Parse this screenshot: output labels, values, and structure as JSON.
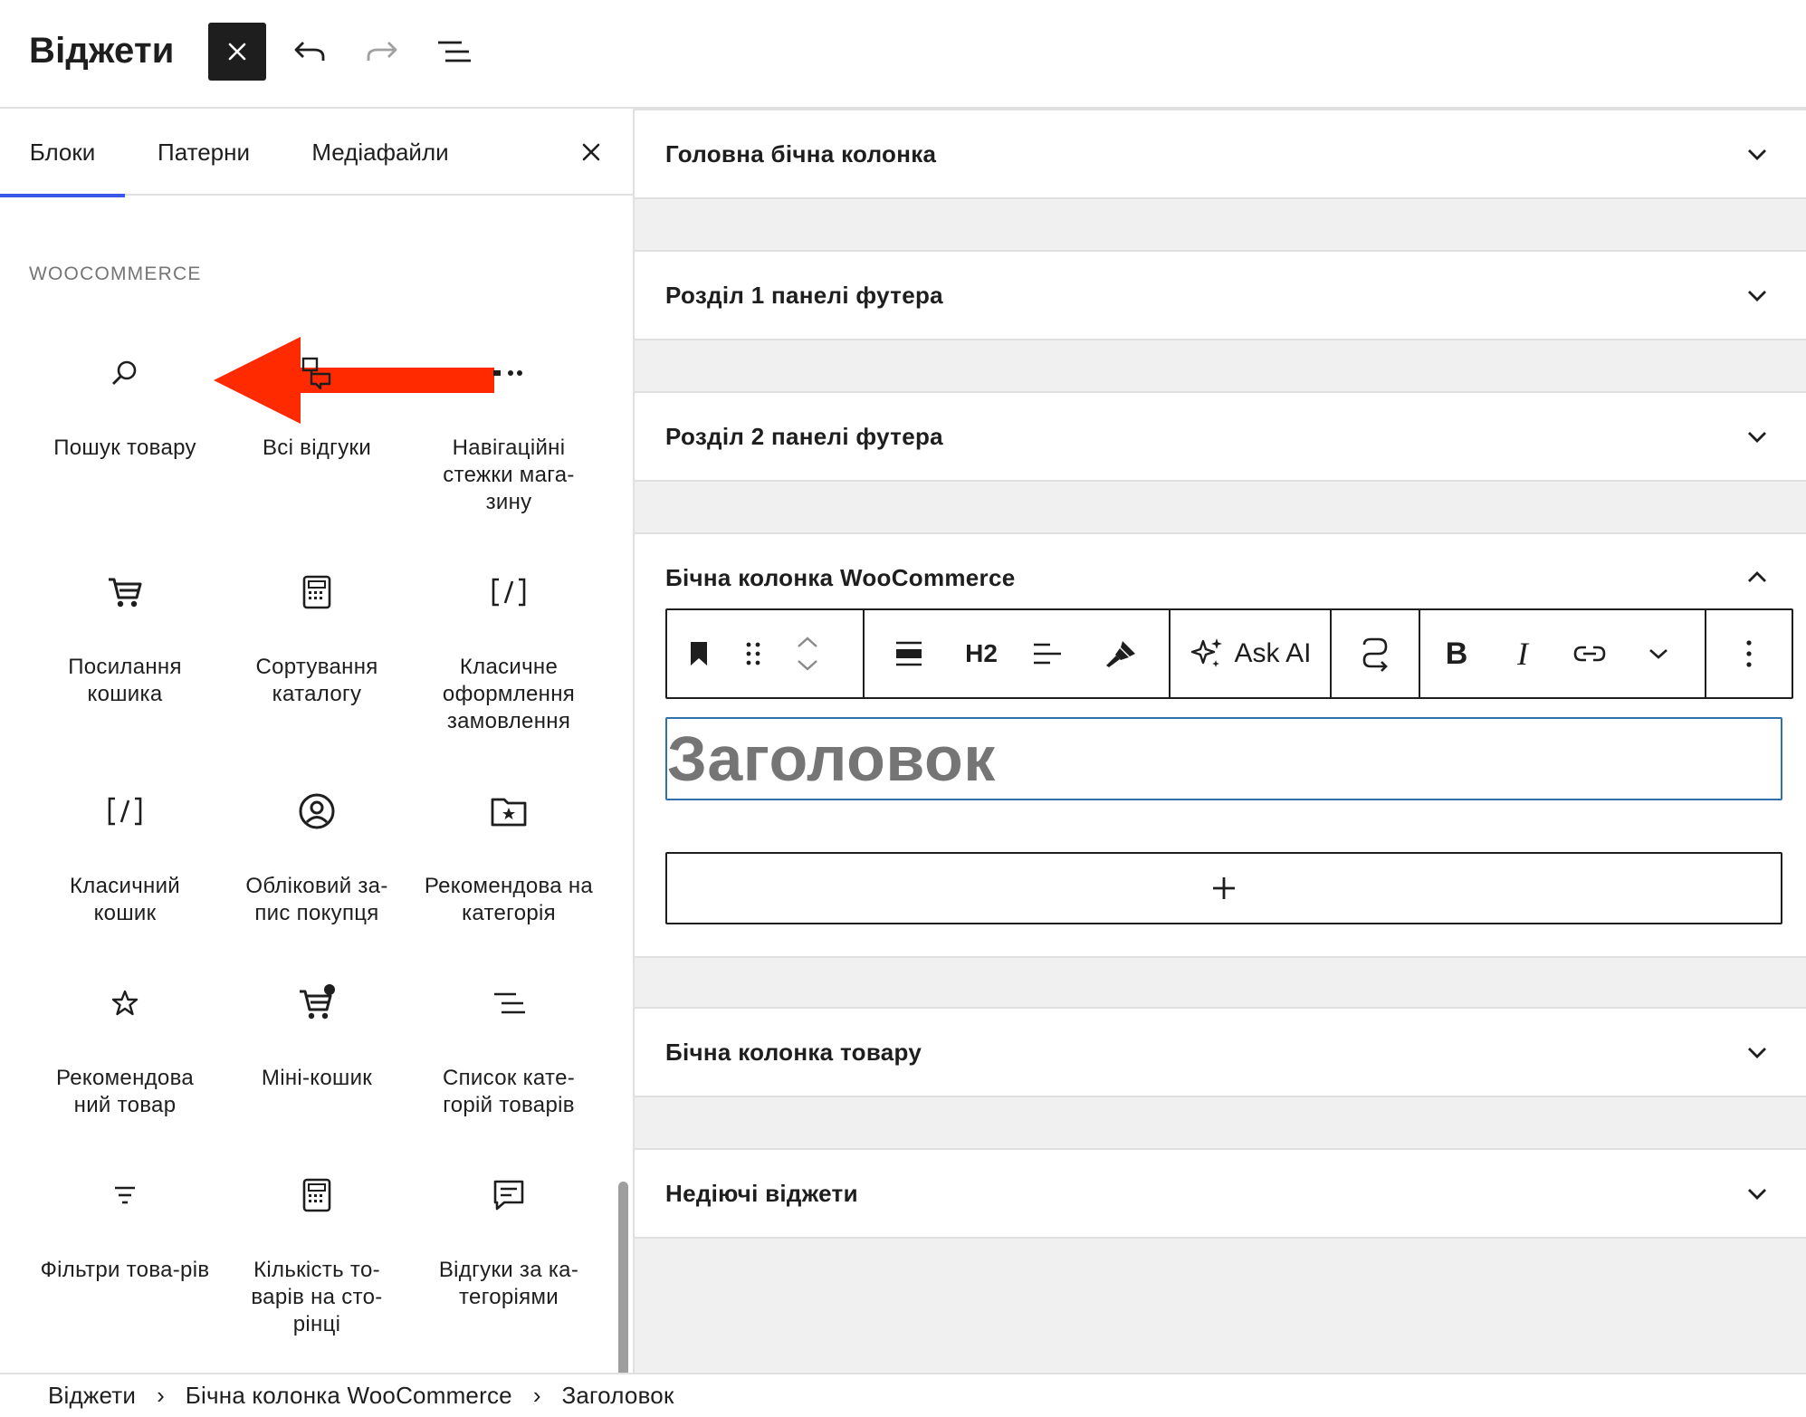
{
  "header": {
    "title": "Віджети",
    "buttons": {
      "close_inserter_icon": "close-icon",
      "undo_icon": "undo-icon",
      "redo_icon": "redo-icon",
      "list_view_icon": "list-view-icon"
    }
  },
  "inserter": {
    "tabs": [
      {
        "label": "Блоки",
        "active": true
      },
      {
        "label": "Патерни",
        "active": false
      },
      {
        "label": "Медіафайли",
        "active": false
      }
    ],
    "category": "WOOCOMMERCE",
    "blocks": [
      {
        "label": "Пошук товару",
        "icon": "search-icon"
      },
      {
        "label": "Всі відгуки",
        "icon": "reviews-icon"
      },
      {
        "label": "Навігаційні стежки мага-зину",
        "icon": "breadcrumbs-icon"
      },
      {
        "label": "Посилання кошика",
        "icon": "cart-icon"
      },
      {
        "label": "Сортування каталогу",
        "icon": "calculator-icon"
      },
      {
        "label": "Класичне оформлення замовлення",
        "icon": "shortcode-icon"
      },
      {
        "label": "Класичний кошик",
        "icon": "shortcode-icon"
      },
      {
        "label": "Обліковий за-пис покупця",
        "icon": "user-circle-icon"
      },
      {
        "label": "Рекомендова на категорія",
        "icon": "folder-star-icon"
      },
      {
        "label": "Рекомендова ний товар",
        "icon": "star-icon"
      },
      {
        "label": "Міні-кошик",
        "icon": "mini-cart-icon"
      },
      {
        "label": "Список кате-горій товарів",
        "icon": "list-icon"
      },
      {
        "label": "Фільтри това-рів",
        "icon": "filter-icon"
      },
      {
        "label": "Кількість то-варів на сто-рінці",
        "icon": "calculator-icon"
      },
      {
        "label": "Відгуки за ка-тегоріями",
        "icon": "comment-icon"
      }
    ]
  },
  "widget_areas": [
    {
      "title": "Головна бічна колонка",
      "expanded": false
    },
    {
      "title": "Розділ 1 панелі футера",
      "expanded": false
    },
    {
      "title": "Розділ 2 панелі футера",
      "expanded": false
    },
    {
      "title": "Бічна колонка WooCommerce",
      "expanded": true
    },
    {
      "title": "Бічна колонка товару",
      "expanded": false
    },
    {
      "title": "Недіючі віджети",
      "expanded": false
    }
  ],
  "block_toolbar": {
    "heading_level": "H2",
    "ask_ai": "Ask AI",
    "bold": "B",
    "italic": "I"
  },
  "heading_block": {
    "placeholder": "Заголовок"
  },
  "breadcrumb": [
    "Віджети",
    "Бічна колонка WooCommerce",
    "Заголовок"
  ],
  "colors": {
    "accent": "#3858e9",
    "focus_border": "#3071a9",
    "annotation_arrow": "#ff2a00",
    "text": "#1e1e1e",
    "muted": "#757575"
  }
}
